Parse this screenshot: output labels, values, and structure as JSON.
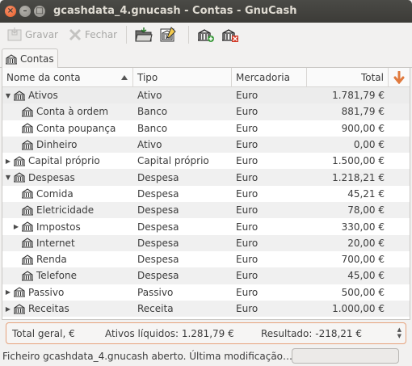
{
  "window": {
    "title": "gcashdata_4.gnucash - Contas - GnuCash"
  },
  "toolbar": {
    "save_label": "Gravar",
    "close_label": "Fechar"
  },
  "tab": {
    "label": "Contas"
  },
  "columns": {
    "name": "Nome da conta",
    "type": "Tipo",
    "commodity": "Mercadoria",
    "total": "Total"
  },
  "accounts": [
    {
      "name": "Ativos",
      "type": "Ativo",
      "commodity": "Euro",
      "total": "1.781,79 €",
      "level": 0,
      "expander": "expanded"
    },
    {
      "name": "Conta à ordem",
      "type": "Banco",
      "commodity": "Euro",
      "total": "881,79 €",
      "level": 1,
      "expander": "none"
    },
    {
      "name": "Conta poupança",
      "type": "Banco",
      "commodity": "Euro",
      "total": "900,00 €",
      "level": 1,
      "expander": "none"
    },
    {
      "name": "Dinheiro",
      "type": "Ativo",
      "commodity": "Euro",
      "total": "0,00 €",
      "level": 1,
      "expander": "none"
    },
    {
      "name": "Capital próprio",
      "type": "Capital próprio",
      "commodity": "Euro",
      "total": "1.500,00 €",
      "level": 0,
      "expander": "collapsed"
    },
    {
      "name": "Despesas",
      "type": "Despesa",
      "commodity": "Euro",
      "total": "1.218,21 €",
      "level": 0,
      "expander": "expanded"
    },
    {
      "name": "Comida",
      "type": "Despesa",
      "commodity": "Euro",
      "total": "45,21 €",
      "level": 1,
      "expander": "none"
    },
    {
      "name": "Eletricidade",
      "type": "Despesa",
      "commodity": "Euro",
      "total": "78,00 €",
      "level": 1,
      "expander": "none"
    },
    {
      "name": "Impostos",
      "type": "Despesa",
      "commodity": "Euro",
      "total": "330,00 €",
      "level": 1,
      "expander": "collapsed"
    },
    {
      "name": "Internet",
      "type": "Despesa",
      "commodity": "Euro",
      "total": "20,00 €",
      "level": 1,
      "expander": "none"
    },
    {
      "name": "Renda",
      "type": "Despesa",
      "commodity": "Euro",
      "total": "700,00 €",
      "level": 1,
      "expander": "none"
    },
    {
      "name": "Telefone",
      "type": "Despesa",
      "commodity": "Euro",
      "total": "45,00 €",
      "level": 1,
      "expander": "none"
    },
    {
      "name": "Passivo",
      "type": "Passivo",
      "commodity": "Euro",
      "total": "500,00 €",
      "level": 0,
      "expander": "collapsed"
    },
    {
      "name": "Receitas",
      "type": "Receita",
      "commodity": "Euro",
      "total": "1.000,00 €",
      "level": 0,
      "expander": "collapsed"
    }
  ],
  "summary": {
    "label": "Total geral, €",
    "net_assets": "Ativos líquidos: 1.281,79 €",
    "result": "Resultado: -218,21 €"
  },
  "status": {
    "text": "Ficheiro gcashdata_4.gnucash aberto. Última modificação…"
  },
  "colors": {
    "accent": "#e07a3e",
    "titlebar": "#3c3b37",
    "close_button": "#e85f28"
  }
}
